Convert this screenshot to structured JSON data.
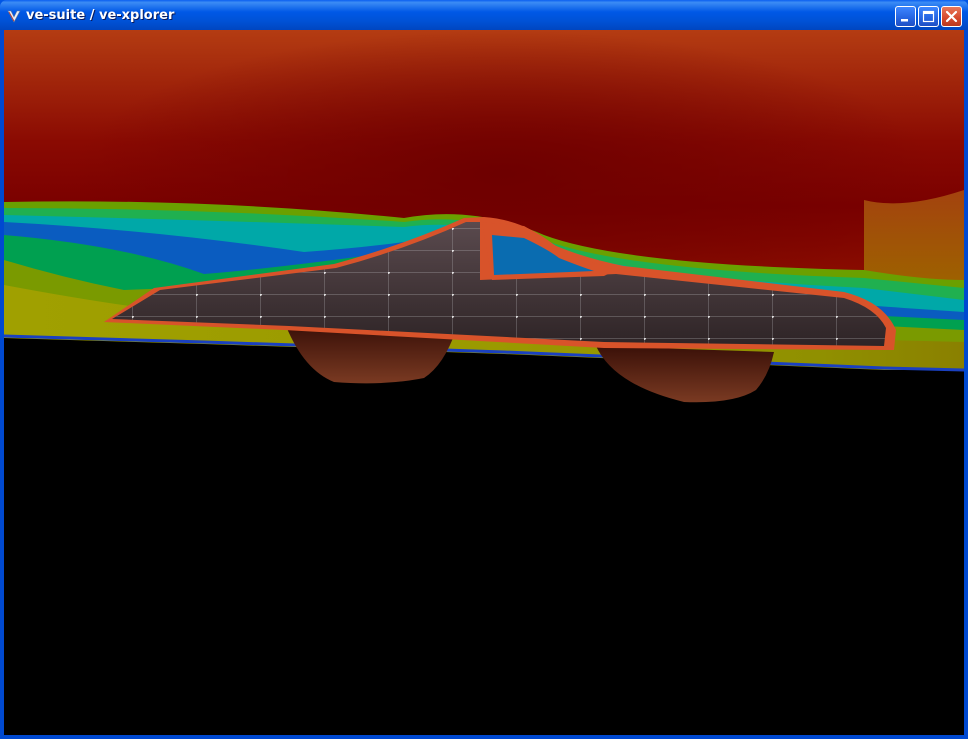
{
  "window": {
    "title": "ve-suite / ve-xplorer",
    "icon": "ve-suite-app-icon",
    "controls": [
      "minimize-icon",
      "maximize-icon",
      "close-icon"
    ]
  },
  "scene": {
    "description_colors": {
      "high": "#7a0000",
      "mid_high": "#b03a10",
      "mid": "#9a9a00",
      "low_mid": "#00a040",
      "low": "#0030a0",
      "car_trim": "#d8532a",
      "canopy": "#0a6cb0",
      "background": "#000000"
    }
  }
}
